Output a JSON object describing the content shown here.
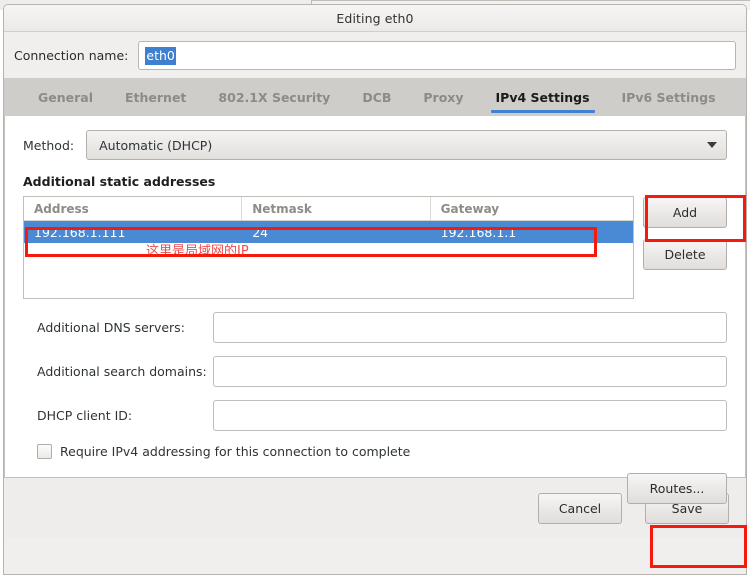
{
  "window": {
    "title": "Editing eth0"
  },
  "connection": {
    "label": "Connection name:",
    "value": "eth0"
  },
  "tabs": [
    {
      "label": "General",
      "active": false
    },
    {
      "label": "Ethernet",
      "active": false
    },
    {
      "label": "802.1X Security",
      "active": false
    },
    {
      "label": "DCB",
      "active": false
    },
    {
      "label": "Proxy",
      "active": false
    },
    {
      "label": "IPv4 Settings",
      "active": true
    },
    {
      "label": "IPv6 Settings",
      "active": false
    }
  ],
  "method": {
    "label": "Method:",
    "value": "Automatic (DHCP)",
    "caret_icon": "chevron-down-icon"
  },
  "addresses": {
    "section_title": "Additional static addresses",
    "columns": [
      "Address",
      "Netmask",
      "Gateway"
    ],
    "rows": [
      {
        "address": "192.168.1.111",
        "netmask": "24",
        "gateway": "192.168.1.1",
        "selected": true
      }
    ],
    "add_label": "Add",
    "delete_label": "Delete",
    "annotation": "这里是局域网的IP"
  },
  "fields": [
    {
      "label": "Additional DNS servers:",
      "value": "",
      "placeholder": ""
    },
    {
      "label": "Additional search domains:",
      "value": "",
      "placeholder": ""
    },
    {
      "label": "DHCP client ID:",
      "value": "",
      "placeholder": ""
    }
  ],
  "checkbox": {
    "label": "Require IPv4 addressing for this connection to complete",
    "checked": false
  },
  "routes": {
    "label": "Routes..."
  },
  "footer": {
    "cancel_label": "Cancel",
    "save_label": "Save"
  },
  "colors": {
    "selection_blue": "#4a8ad4",
    "tab_accent": "#3e82d2",
    "annotation_red": "#f41b0c",
    "annotation_text_red": "#ef4b4b",
    "tabbar_bg": "#cfcdc9"
  }
}
